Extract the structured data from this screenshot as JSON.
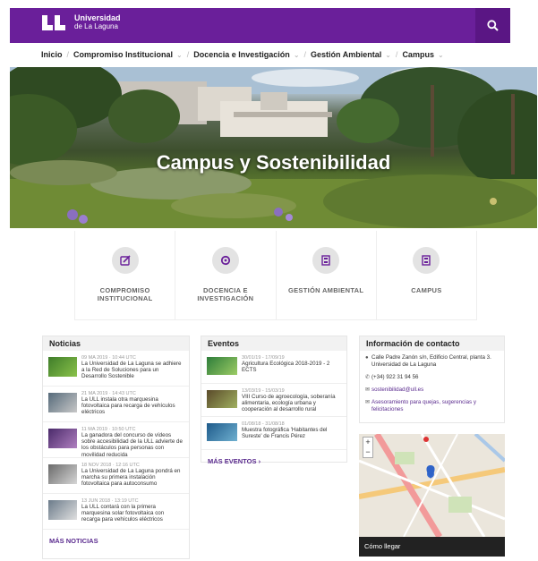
{
  "header": {
    "logo_line1": "Universidad",
    "logo_line2": "de La Laguna",
    "search_icon": "search-icon",
    "brand_color": "#6a1f9a"
  },
  "nav": {
    "items": [
      {
        "label": "Inicio",
        "dropdown": false
      },
      {
        "label": "Compromiso Institucional",
        "dropdown": true
      },
      {
        "label": "Docencia e Investigación",
        "dropdown": true
      },
      {
        "label": "Gestión Ambiental",
        "dropdown": true
      },
      {
        "label": "Campus",
        "dropdown": true
      }
    ]
  },
  "hero": {
    "title": "Campus y Sostenibilidad"
  },
  "categories": [
    {
      "label": "COMPROMISO INSTITUCIONAL",
      "icon": "edit-icon"
    },
    {
      "label": "DOCENCIA E INVESTIGACIÓN",
      "icon": "settings-icon"
    },
    {
      "label": "GESTIÓN AMBIENTAL",
      "icon": "building-icon"
    },
    {
      "label": "CAMPUS",
      "icon": "building-icon"
    }
  ],
  "noticias": {
    "title": "Noticias",
    "items": [
      {
        "date": "09 MA 2019 · 10:44 UTC",
        "text": "La Universidad de La Laguna se adhiere a la Red de Soluciones para un Desarrollo Sostenible"
      },
      {
        "date": "21 MA 2019 · 14:43 UTC",
        "text": "La ULL instala otra marquesina fotovoltaica para recarga de vehículos eléctricos"
      },
      {
        "date": "11 MA 2019 · 10:50 UTC",
        "text": "La ganadora del concurso de vídeos sobre accesibilidad de la ULL advierte de los obstáculos para personas con movilidad reducida"
      },
      {
        "date": "18 NOV 2018 · 12:16 UTC",
        "text": "La Universidad de La Laguna pondrá en marcha su primera instalación fotovoltaica para autoconsumo"
      },
      {
        "date": "13 JUN 2018 · 13:19 UTC",
        "text": "La ULL contará con la primera marquesina solar fotovoltaica con recarga para vehículos eléctricos"
      }
    ],
    "more": "MÁS NOTICIAS"
  },
  "eventos": {
    "title": "Eventos",
    "items": [
      {
        "date": "30/01/19 - 17/09/19",
        "text": "Agricultura Ecológica 2018-2019 - 2 ECTS"
      },
      {
        "date": "13/03/19 - 15/03/19",
        "text": "VIII Curso de agroecología, soberanía alimentaria, ecología urbana y cooperación al desarrollo rural"
      },
      {
        "date": "01/08/18 - 31/08/18",
        "text": "Muestra fotográfica 'Habitantes del Sureste' de Francis Pérez"
      }
    ],
    "more": "MÁS EVENTOS"
  },
  "contacto": {
    "title": "Información de contacto",
    "address": "Calle Padre Zanón s/n, Edificio Central, planta 3. Universidad de La Laguna",
    "phone": "(+34) 922 31 94 56",
    "email": "sostenibilidad@ull.es",
    "suggestions": "Asesoramiento para quejas, sugerencias y felicitaciones",
    "map_cta": "Cómo llegar"
  }
}
